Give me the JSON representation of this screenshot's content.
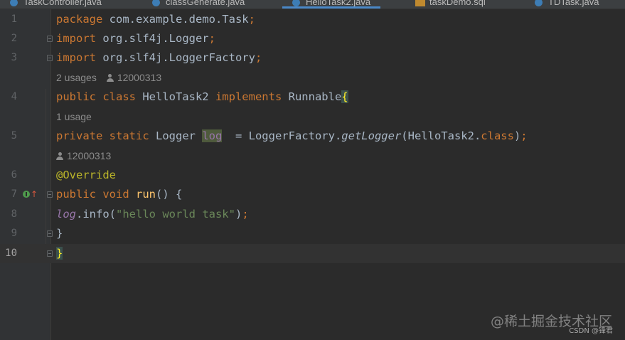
{
  "tabs": [
    {
      "label": "TaskController.java",
      "icon": "java-class-icon"
    },
    {
      "label": "classGenerate.java",
      "icon": "java-class-icon"
    },
    {
      "label": "HelloTask2.java",
      "icon": "java-class-icon",
      "active": true
    },
    {
      "label": "taskDemo.sql",
      "icon": "sql-file-icon"
    },
    {
      "label": "TDTask.java",
      "icon": "java-class-icon"
    }
  ],
  "lines": {
    "l1": {
      "num": "1",
      "t1": "package",
      "t2": " com.example.demo.Task",
      "t3": ";"
    },
    "l2": {
      "num": "2",
      "t1": "import",
      "t2": " org.slf4j.Logger",
      "t3": ";"
    },
    "l3": {
      "num": "3",
      "t1": "import",
      "t2": " org.slf4j.LoggerFactory",
      "t3": ";"
    },
    "l4": {
      "num": "4",
      "t1": "public class",
      "t2": " HelloTask2 ",
      "t3": "implements",
      "t4": " Runnable",
      "t5": "{"
    },
    "l5": {
      "num": "5",
      "t1": "private static",
      "t2": " Logger ",
      "t3": "log",
      "t4": "  = LoggerFactory.",
      "t5": "getLogger",
      "t6": "(HelloTask2.",
      "t7": "class",
      "t8": ")",
      "t9": ";"
    },
    "l6": {
      "num": "6",
      "t1": "@Override"
    },
    "l7": {
      "num": "7",
      "t1": "public void",
      "t2": " ",
      "t3": "run",
      "t4": "() {"
    },
    "l8": {
      "num": "8",
      "t1": "log",
      "t2": ".info(",
      "t3": "\"hello world task\"",
      "t4": ")",
      "t5": ";"
    },
    "l9": {
      "num": "9",
      "t1": "}"
    },
    "l10": {
      "num": "10",
      "t1": "}"
    }
  },
  "hints": {
    "h1": {
      "usages": "2 usages",
      "author": "12000313"
    },
    "h2": {
      "usages": "1 usage"
    },
    "h3": {
      "author": "12000313"
    }
  },
  "watermark": {
    "text": "@稀土掘金技术社区",
    "csdn": "CSDN @锋君"
  },
  "colors": {
    "background": "#2b2b2b",
    "keyword": "#cc7832",
    "annotation": "#bbb529",
    "field": "#9876aa",
    "method": "#ffc66d",
    "string": "#6a8759",
    "text": "#a9b7c6",
    "tab_underline": "#4a88c7"
  }
}
